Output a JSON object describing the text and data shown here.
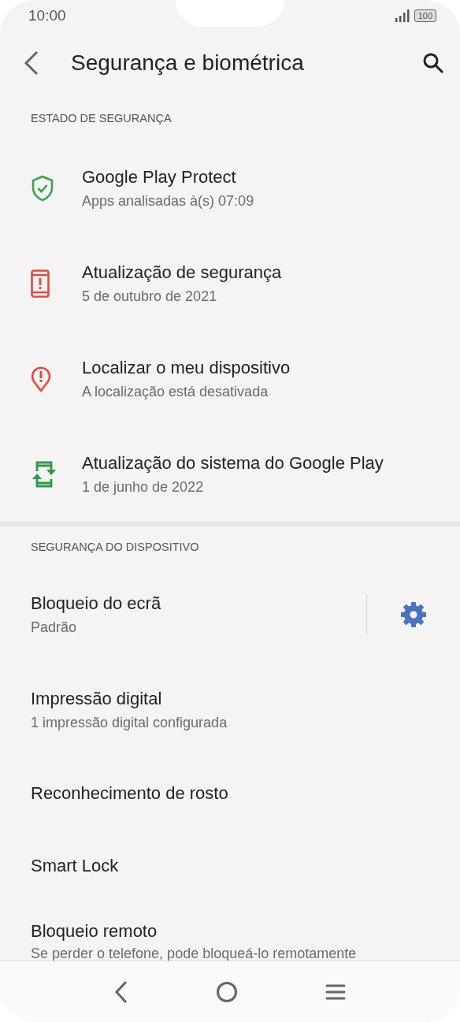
{
  "status_bar": {
    "time": "10:00",
    "battery": "100"
  },
  "app_bar": {
    "title": "Segurança e biométrica"
  },
  "sections": [
    {
      "header": "ESTADO DE SEGURANÇA",
      "items": [
        {
          "kind": "icon",
          "title": "Google Play Protect",
          "subtitle": "Apps analisadas à(s) 07:09",
          "color": "#3ea04a"
        },
        {
          "kind": "icon",
          "title": "Atualização de segurança",
          "subtitle": "5 de outubro de 2021",
          "color": "#e8473c"
        },
        {
          "kind": "icon",
          "title": "Localizar o meu dispositivo",
          "subtitle": "A localização está desativada",
          "color": "#e8473c"
        },
        {
          "kind": "icon",
          "title": "Atualização do sistema do Google Play",
          "subtitle": "1 de junho de 2022",
          "color": "#2e9a45"
        }
      ]
    },
    {
      "header": "SEGURANÇA DO DISPOSITIVO",
      "items": [
        {
          "kind": "settings",
          "title": "Bloqueio do ecrã",
          "subtitle": "Padrão"
        },
        {
          "kind": "plain",
          "title": "Impressão digital",
          "subtitle": "1 impressão digital configurada"
        },
        {
          "kind": "plain",
          "title": "Reconhecimento de rosto"
        },
        {
          "kind": "plain",
          "title": "Smart Lock"
        },
        {
          "kind": "plain",
          "title": "Bloqueio remoto",
          "subtitle": "Se perder o telefone, pode bloqueá-lo remotamente"
        }
      ]
    }
  ]
}
